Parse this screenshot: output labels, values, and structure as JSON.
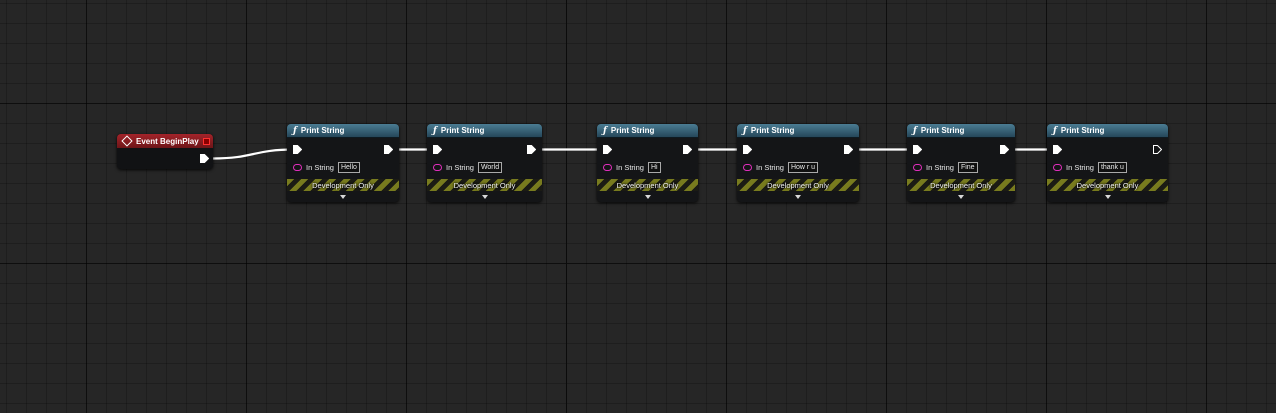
{
  "event_node": {
    "title": "Event BeginPlay",
    "color": "#a3242a"
  },
  "function_nodes": [
    {
      "title": "Print String",
      "in_string_label": "In String",
      "value": "Hello",
      "banner": "Development Only",
      "out_exec_connected": true
    },
    {
      "title": "Print String",
      "in_string_label": "In String",
      "value": "World",
      "banner": "Development Only",
      "out_exec_connected": true
    },
    {
      "title": "Print String",
      "in_string_label": "In String",
      "value": "Hi",
      "banner": "Development Only",
      "out_exec_connected": true
    },
    {
      "title": "Print String",
      "in_string_label": "In String",
      "value": "How r u",
      "banner": "Development Only",
      "out_exec_connected": true
    },
    {
      "title": "Print String",
      "in_string_label": "In String",
      "value": "Fine",
      "banner": "Development Only",
      "out_exec_connected": true
    },
    {
      "title": "Print String",
      "in_string_label": "In String",
      "value": "thank u",
      "banner": "Development Only",
      "out_exec_connected": false
    }
  ],
  "colors": {
    "function_header": "#4a7c93",
    "string_pin": "#e02dbb",
    "exec_wire": "#ffffff",
    "background": "#262626",
    "dev_stripe": "#787b1e"
  },
  "icons": {
    "event": "diamond-icon",
    "function": "function-icon",
    "exec_pin": "exec-pin-icon",
    "string_pin": "string-pin-icon",
    "expand": "chevron-down-icon"
  }
}
